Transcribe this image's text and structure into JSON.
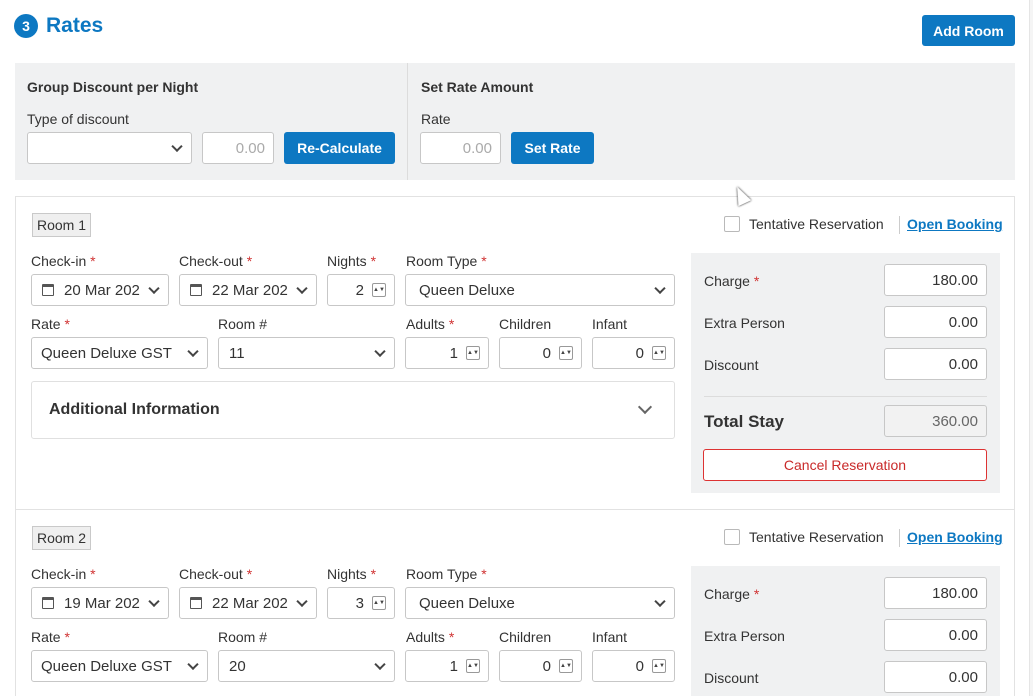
{
  "header": {
    "step": "3",
    "title": "Rates",
    "add_room": "Add Room"
  },
  "group_discount": {
    "heading": "Group Discount per Night",
    "type_label": "Type of discount",
    "type_value": "",
    "amount_placeholder": "0.00",
    "recalc_label": "Re-Calculate"
  },
  "set_rate": {
    "heading": "Set Rate Amount",
    "rate_label": "Rate",
    "rate_placeholder": "0.00",
    "set_label": "Set Rate"
  },
  "labels": {
    "checkin": "Check-in",
    "checkout": "Check-out",
    "nights": "Nights",
    "room_type": "Room Type",
    "rate": "Rate",
    "room_no": "Room #",
    "adults": "Adults",
    "children": "Children",
    "infant": "Infant",
    "required": "*",
    "tentative": "Tentative Reservation",
    "open_booking": "Open Booking",
    "additional": "Additional Information",
    "charge": "Charge",
    "extra_person": "Extra Person",
    "discount": "Discount",
    "total_stay": "Total Stay",
    "cancel": "Cancel Reservation"
  },
  "rooms": [
    {
      "badge": "Room 1",
      "checkin": "20 Mar 202",
      "checkout": "22 Mar 202",
      "nights": "2",
      "room_type": "Queen Deluxe",
      "rate": "Queen Deluxe GST",
      "room_no": "11",
      "adults": "1",
      "children": "0",
      "infant": "0",
      "charge": "180.00",
      "extra_person": "0.00",
      "discount": "0.00",
      "total": "360.00"
    },
    {
      "badge": "Room 2",
      "checkin": "19 Mar 202",
      "checkout": "22 Mar 202",
      "nights": "3",
      "room_type": "Queen Deluxe",
      "rate": "Queen Deluxe GST",
      "room_no": "20",
      "adults": "1",
      "children": "0",
      "infant": "0",
      "charge": "180.00",
      "extra_person": "0.00",
      "discount": "0.00"
    }
  ]
}
